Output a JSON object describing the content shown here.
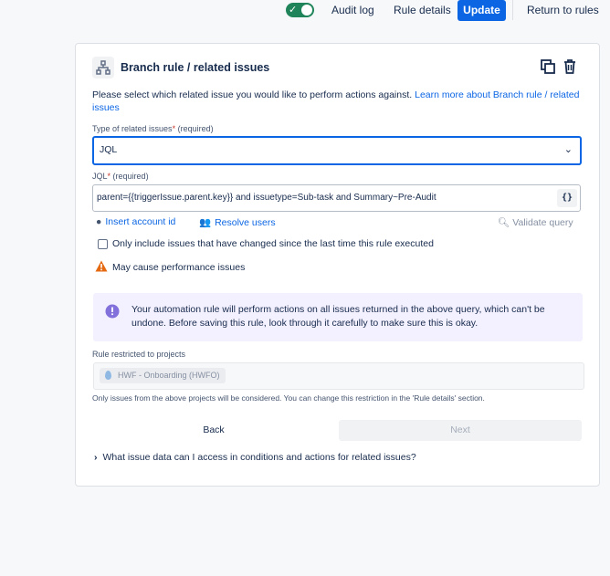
{
  "topbar": {
    "audit_log": "Audit log",
    "rule_details": "Rule details",
    "update": "Update",
    "return_to_rules": "Return to rules",
    "toggle_state": "on"
  },
  "header": {
    "title": "Branch rule / related issues",
    "icon": "branch-icon"
  },
  "intro": {
    "text": "Please select which related issue you would like to perform actions against.",
    "link_text": "Learn more about Branch rule / related issues"
  },
  "related_type": {
    "label": "Type of related issues",
    "required_star": "*",
    "required_note": "(required)",
    "value": "JQL"
  },
  "jql": {
    "label": "JQL",
    "required_star": "*",
    "required_note": "(required)",
    "value": "parent={{triggerIssue.parent.key}} and issuetype=Sub-task and Summary~Pre-Audit",
    "brace_button": "{}"
  },
  "actions": {
    "insert_account_id": "Insert account id",
    "resolve_users": "Resolve users",
    "validate_query": "Validate query"
  },
  "checkbox": {
    "label": "Only include issues that have changed since the last time this rule executed",
    "checked": false
  },
  "warning": {
    "text": "May cause performance issues"
  },
  "info": {
    "text": "Your automation rule will perform actions on all issues returned in the above query, which can't be undone. Before saving this rule, look through it carefully to make sure this is okay."
  },
  "projects": {
    "label": "Rule restricted to projects",
    "project": "HWF - Onboarding (HWFO)",
    "note": "Only issues from the above projects will be considered. You can change this restriction in the 'Rule details' section."
  },
  "buttons": {
    "back": "Back",
    "next": "Next"
  },
  "faq": {
    "text": "What issue data can I access in conditions and actions for related issues?"
  },
  "colors": {
    "primary": "#0c66e4",
    "toggle_on": "#1f845a",
    "warning": "#e56910",
    "info_bg": "#f3f0ff",
    "discovery": "#8270db"
  }
}
